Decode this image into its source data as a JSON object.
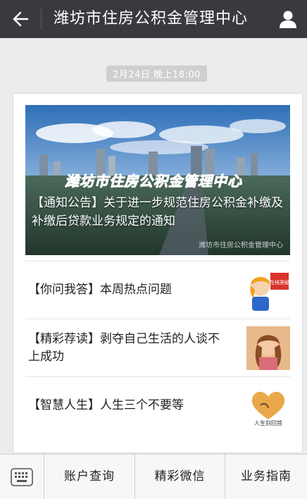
{
  "header": {
    "back_icon": "arrow-left-icon",
    "title": "潍坊市住房公积金管理中心",
    "profile_icon": "person-icon"
  },
  "timestamp": "2月24日 晚上18:00",
  "article": {
    "cover_banner": "潍坊市住房公积金管理中心",
    "cover_title": "【通知公告】关于进一步规范住房公积金补缴及补缴后贷款业务规定的通知",
    "cover_watermark": "潍坊市住房公积金管理中心",
    "items": [
      {
        "title": "【你问我答】本周热点问题",
        "thumb_text": "在线答疑"
      },
      {
        "title": "【精彩荐读】剥夺自己生活的人谈不上成功"
      },
      {
        "title": "【智慧人生】人生三个不要等",
        "thumb_text": "人生别回首"
      }
    ]
  },
  "menu": {
    "keyboard_icon": "keyboard-icon",
    "items": [
      "账户查询",
      "精彩微信",
      "业务指南"
    ]
  },
  "colors": {
    "topbar": "#393a3f",
    "background": "#ececec",
    "banner_blue": "#2f7fd8"
  }
}
